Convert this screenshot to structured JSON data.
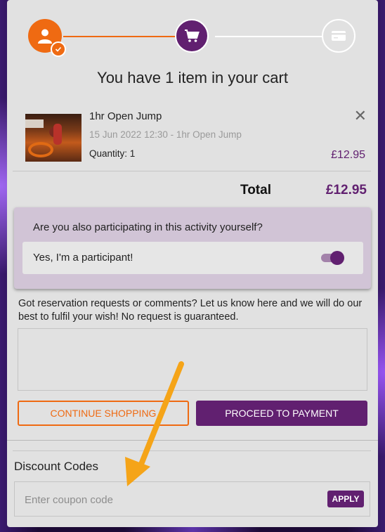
{
  "colors": {
    "accent": "#612070",
    "orange": "#ef6a12",
    "card": "#e1e1e1"
  },
  "stepper": {
    "steps": [
      {
        "icon": "user-check-icon",
        "state": "complete"
      },
      {
        "icon": "cart-icon",
        "state": "active"
      },
      {
        "icon": "credit-card-icon",
        "state": "pending"
      }
    ]
  },
  "cart": {
    "title": "You have 1 item in your cart"
  },
  "item": {
    "name": "1hr Open Jump",
    "date": "15 Jun 2022 12:30 - 1hr Open Jump",
    "quantity": "Quantity: 1",
    "price": "£12.95",
    "remove": "✕"
  },
  "total": {
    "label": "Total",
    "value": "£12.95"
  },
  "participant": {
    "question": "Are you also participating in this activity yourself?",
    "option_label": "Yes, I'm a participant!",
    "toggle_on": true
  },
  "comments": {
    "help": "Got reservation requests or comments? Let us know here and we will do our best to fulfil your wish! No request is guaranteed.",
    "value": ""
  },
  "buttons": {
    "continue": "CONTINUE SHOPPING",
    "proceed": "PROCEED TO PAYMENT"
  },
  "discount": {
    "title": "Discount Codes",
    "placeholder": "Enter coupon code",
    "apply": "APPLY"
  }
}
